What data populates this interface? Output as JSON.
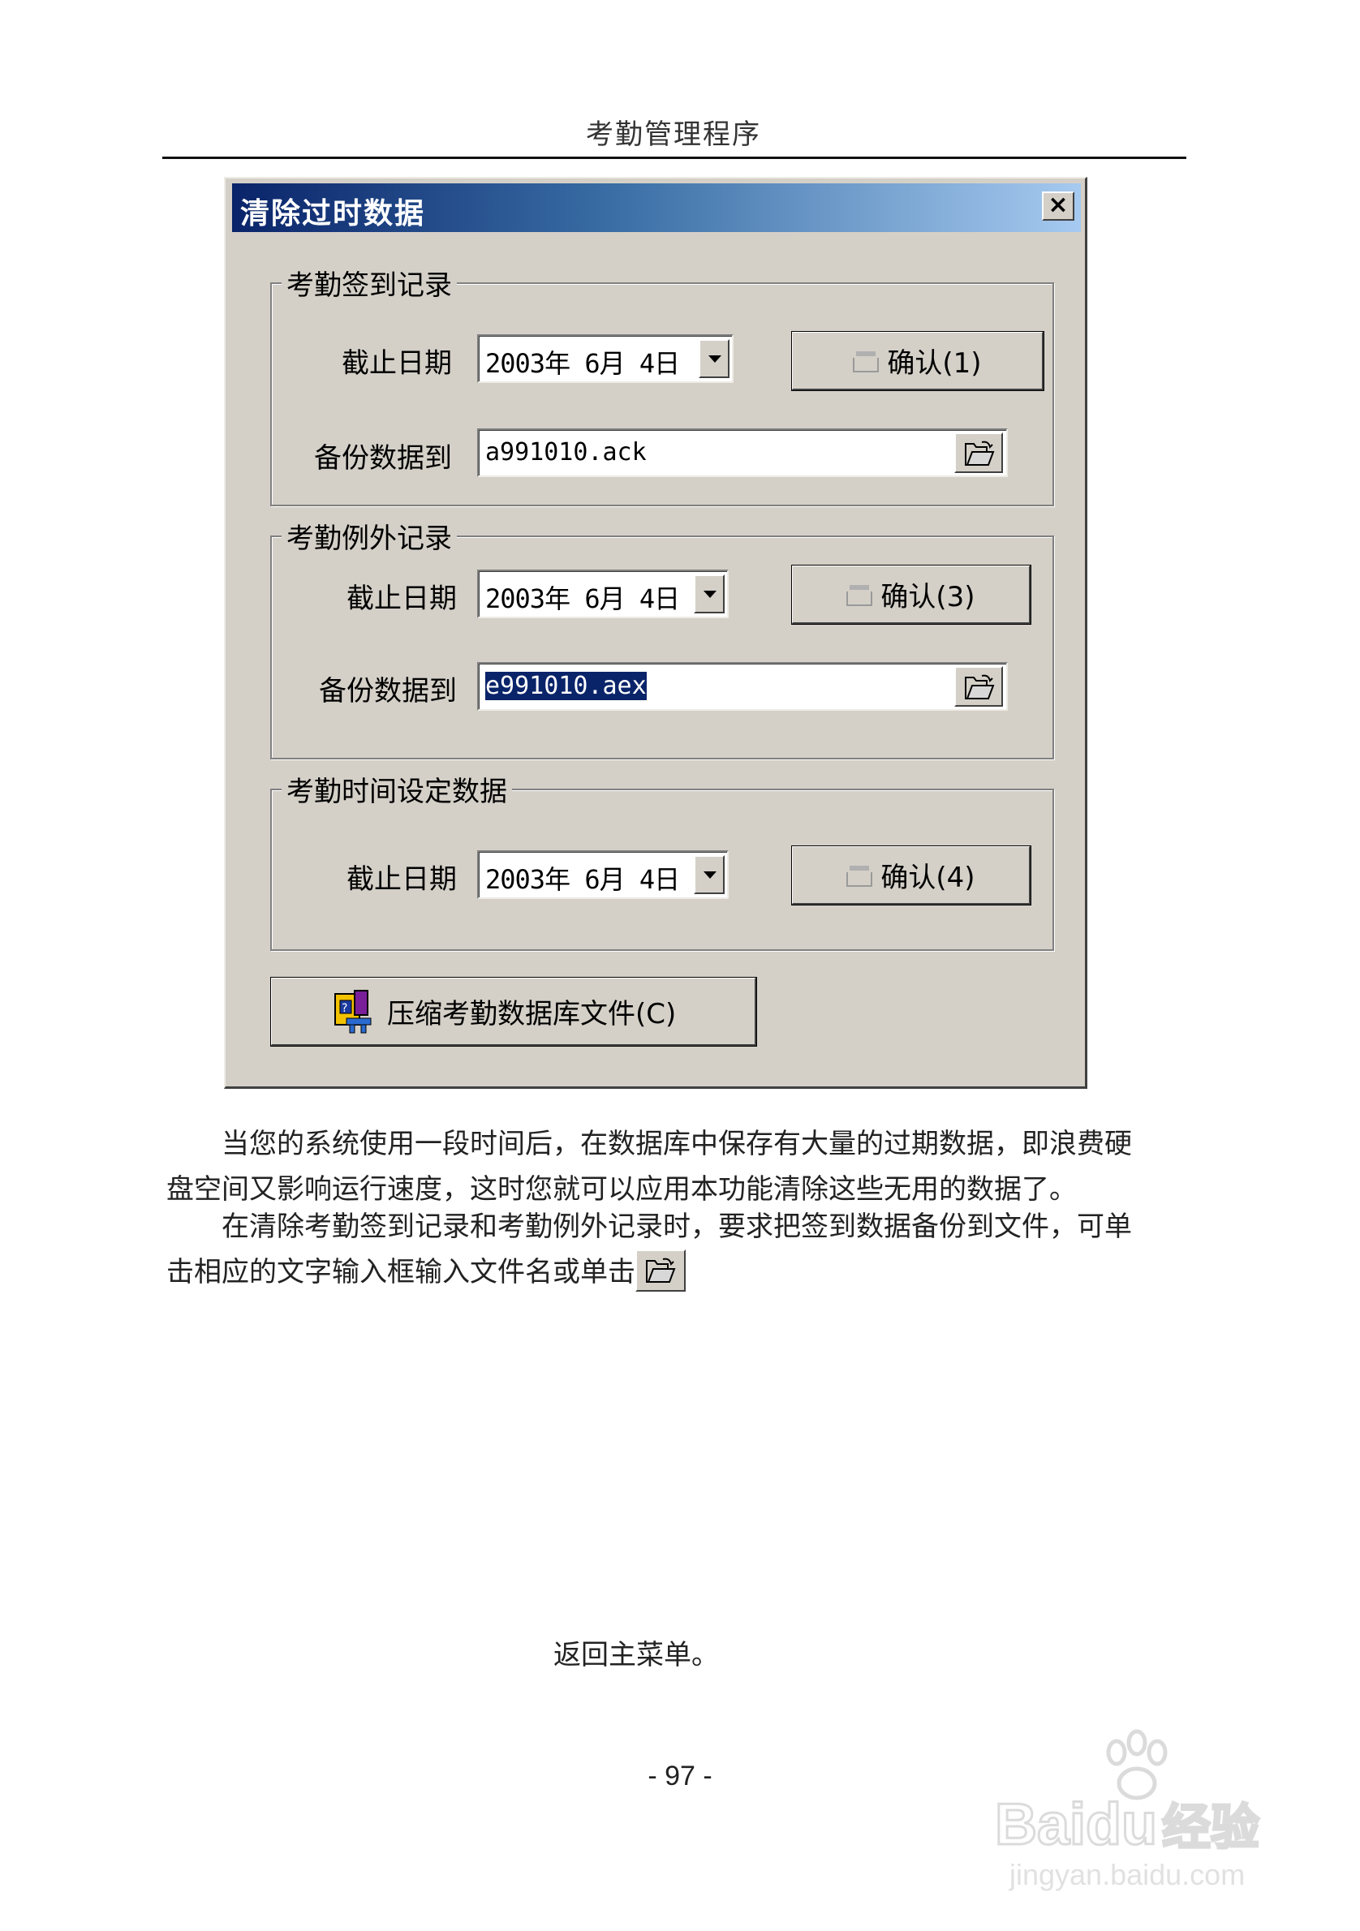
{
  "page": {
    "header": "考勤管理程序",
    "page_number": "- 97 -",
    "watermark": {
      "brand": "Bai",
      "brand2": "du",
      "product": "经验",
      "url": "jingyan.baidu.com"
    }
  },
  "dialog": {
    "title": "清除过时数据",
    "close_label": "×",
    "sign_in_group": {
      "title": "考勤签到记录",
      "date_label": "截止日期",
      "date_value": "2003年 6月 4日",
      "confirm_label": "确认(1)",
      "backup_label": "备份数据到",
      "backup_value": "a991010.ack"
    },
    "exception_group": {
      "title": "考勤例外记录",
      "date_label": "截止日期",
      "date_value": "2003年 6月 4日",
      "confirm_label": "确认(3)",
      "backup_label": "备份数据到",
      "backup_value": "e991010.aex"
    },
    "time_setting_group": {
      "title": "考勤时间设定数据",
      "date_label": "截止日期",
      "date_value": "2003年 6月 4日",
      "confirm_label": "确认(4)"
    },
    "compress_label": "压缩考勤数据库文件(C)"
  },
  "body": {
    "paragraph1_line1": "当您的系统使用一段时间后，在数据库中保存有大量的过期数据，即浪费硬",
    "paragraph1_line2": "盘空间又影响运行速度，这时您就可以应用本功能清除这些无用的数据了。",
    "paragraph2_line1": "在清除考勤签到记录和考勤例外记录时，要求把签到数据备份到文件，可单",
    "paragraph2_line2": "击相应的文字输入框输入文件名或单击",
    "return_text": "返回主菜单。"
  },
  "colors": {
    "dialog_face": "#d4d0c8",
    "titlebar_start": "#0a246a",
    "titlebar_end": "#a6caf0",
    "selection": "#0a246a"
  }
}
